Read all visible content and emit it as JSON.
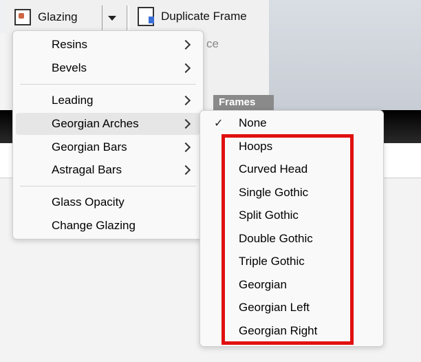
{
  "toolbar": {
    "glazing_label": "Glazing",
    "duplicate_label": "Duplicate Frame",
    "ghost_text": "ce",
    "frames_label": "Frames"
  },
  "main_menu": {
    "items": [
      {
        "label": "Resins",
        "submenu": true
      },
      {
        "label": "Bevels",
        "submenu": true
      },
      {
        "label": "Leading",
        "submenu": true
      },
      {
        "label": "Georgian Arches",
        "submenu": true,
        "highlighted": true
      },
      {
        "label": "Georgian Bars",
        "submenu": true
      },
      {
        "label": "Astragal Bars",
        "submenu": true
      },
      {
        "label": "Glass Opacity",
        "submenu": false
      },
      {
        "label": "Change Glazing",
        "submenu": false
      }
    ]
  },
  "sub_menu": {
    "check_glyph": "✓",
    "items": [
      {
        "label": "None",
        "checked": true
      },
      {
        "label": "Hoops"
      },
      {
        "label": "Curved Head"
      },
      {
        "label": "Single Gothic"
      },
      {
        "label": "Split Gothic"
      },
      {
        "label": "Double Gothic"
      },
      {
        "label": "Triple Gothic"
      },
      {
        "label": "Georgian"
      },
      {
        "label": "Georgian Left"
      },
      {
        "label": "Georgian Right"
      }
    ]
  },
  "colors": {
    "highlight_box": "#e01010",
    "menu_bg": "#f9f9f9",
    "hover_bg": "#e6e6e6"
  }
}
